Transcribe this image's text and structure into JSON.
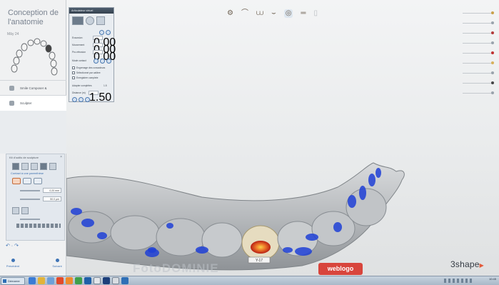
{
  "app": {
    "step_title": "Conception de l'anatomie",
    "tooth_label": "Mây 24",
    "brand": "3shape",
    "colors": {
      "accent": "#3e73b5",
      "model_gray": "#c9ccce",
      "contact_blue": "#1f3fd6",
      "sidebar_bg": "#f0f1f2"
    }
  },
  "sidebar": {
    "steps": [
      {
        "label": "Smile Composer &",
        "icon": "smile-composer-icon"
      },
      {
        "label": "Sculpter",
        "icon": "sculpt-tool-icon",
        "active": true
      }
    ],
    "toolbox": {
      "title": "Kit d'outils de sculpture",
      "section": "Contact à une parenthèse",
      "sliders": [
        {
          "value": "0.20 mm"
        },
        {
          "value": "50.0 µm"
        },
        {
          "value": ""
        }
      ]
    },
    "nav": {
      "prev": "Précédent",
      "next": "Suivant"
    }
  },
  "articulator_panel": {
    "title": "Articulateur virtuel",
    "rows": [
      {
        "label": "Excursion",
        "value": "0.00"
      },
      {
        "label": "Mouvement",
        "value": "0.00"
      },
      {
        "label": "Pro-rétrusion",
        "value": "0.00"
      }
    ],
    "mode_label": "Mode contact",
    "checks": [
      "Engrenage des concadeurs",
      "Sélectionné par calibre",
      "Enregistrer complete"
    ],
    "adjust_label": "Adapter complètes",
    "adjust_value": "1.5",
    "distance_label": "Distance (m)",
    "distance_value": "1.50"
  },
  "top_toolbar": {
    "icons": [
      "articulator-icon",
      "upper-jaw-icon",
      "both-jaws-icon",
      "lower-jaw-icon",
      "tooth-view-icon",
      "scan-icon",
      "preparation-icon"
    ],
    "selected_index": 4
  },
  "viewport": {
    "tooth_tag": "Y-17"
  },
  "watermarks": {
    "left": "FotoDOMINIE",
    "right": "weblogo"
  },
  "taskbar": {
    "start_label": "Démarrer",
    "time": "10:45"
  }
}
